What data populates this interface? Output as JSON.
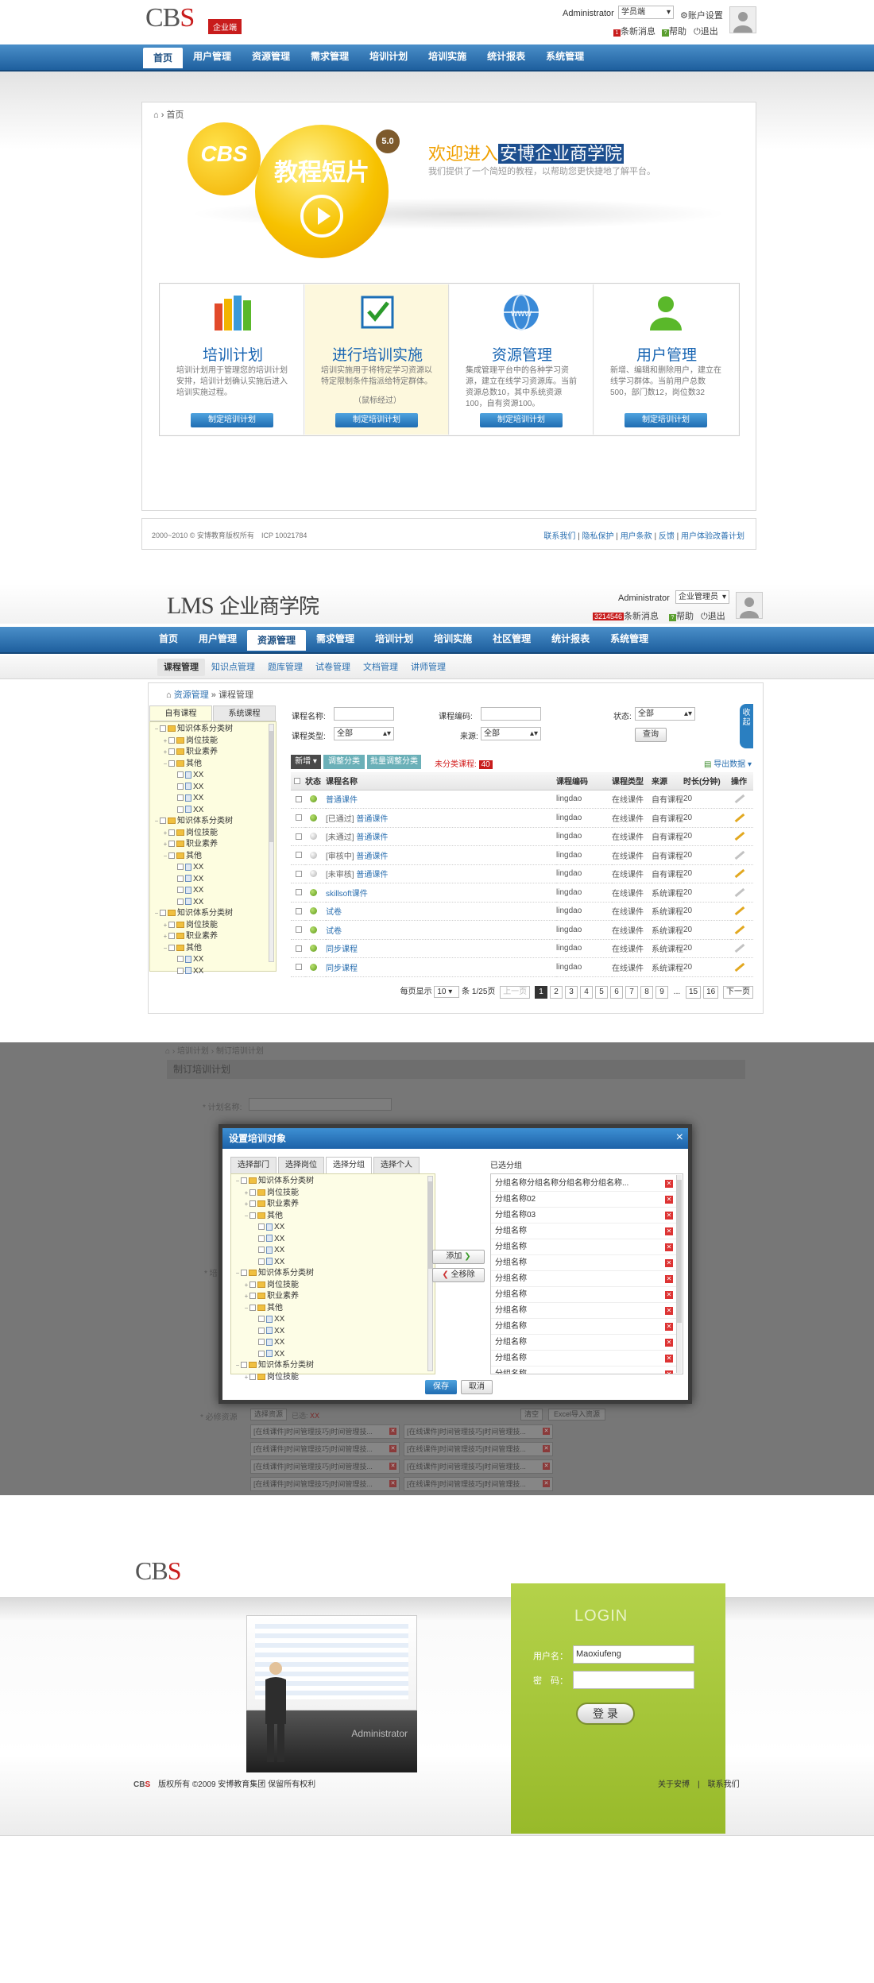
{
  "s1": {
    "logo_a": "CB",
    "logo_b": "S",
    "tag": "企业端",
    "user": "Administrator",
    "role": "学员端",
    "settings": "账户设置",
    "msgs_count": "1",
    "msgs": "条新消息",
    "help": "帮助",
    "logout": "退出",
    "nav": [
      "首页",
      "用户管理",
      "资源管理",
      "需求管理",
      "培训计划",
      "培训实施",
      "统计报表",
      "系统管理"
    ],
    "crumb": "首页",
    "hero": {
      "cbs": "CBS",
      "title": "教程短片",
      "ver": "5.0",
      "welcome_pre": "欢迎进入",
      "welcome_hl": "安博企业商学院",
      "sub": "我们提供了一个简短的教程，以帮助您更快捷地了解平台。"
    },
    "cards": [
      {
        "title": "培训计划",
        "desc": "培训计划用于管理您的培训计划安排，培训计划确认实施后进入培训实施过程。",
        "note": "",
        "btn": "制定培训计划"
      },
      {
        "title": "进行培训实施",
        "desc": "培训实施用于将特定学习资源以特定限制条件指派给特定群体。",
        "note": "（鼠标经过）",
        "btn": "制定培训计划"
      },
      {
        "title": "资源管理",
        "desc": "集成管理平台中的各种学习资源，建立在线学习资源库。当前资源总数10，其中系统资源100，自有资源100。",
        "note": "",
        "btn": "制定培训计划"
      },
      {
        "title": "用户管理",
        "desc": "新增、编辑和删除用户，建立在线学习群体。当前用户总数500，部门数12，岗位数32",
        "note": "",
        "btn": "制定培训计划"
      }
    ],
    "footer_copy": "2000~2010 © 安博教育版权所有",
    "footer_icp": "ICP 10021784",
    "footer_links": [
      "联系我们",
      "隐私保护",
      "用户条款",
      "反馈",
      "用户体验改善计划"
    ]
  },
  "s2": {
    "logo_a": "LMS",
    "logo_b": "企业商学院",
    "user": "Administrator",
    "role": "企业管理员",
    "msgs_count": "3214546",
    "msgs": "条新消息",
    "help": "帮助",
    "logout": "退出",
    "nav": [
      "首页",
      "用户管理",
      "资源管理",
      "需求管理",
      "培训计划",
      "培训实施",
      "社区管理",
      "统计报表",
      "系统管理"
    ],
    "subnav": [
      "课程管理",
      "知识点管理",
      "题库管理",
      "试卷管理",
      "文档管理",
      "讲师管理"
    ],
    "crumb_link": "资源管理",
    "crumb_sep": "»",
    "crumb_cur": "课程管理",
    "tabs": [
      "自有课程",
      "系统课程"
    ],
    "tree": [
      {
        "d": 0,
        "t": "f",
        "l": "知识体系分类树",
        "tg": "−"
      },
      {
        "d": 1,
        "t": "f",
        "l": "岗位技能",
        "tg": "+"
      },
      {
        "d": 1,
        "t": "f",
        "l": "职业素养",
        "tg": "+"
      },
      {
        "d": 1,
        "t": "f",
        "l": "其他",
        "tg": "−"
      },
      {
        "d": 2,
        "t": "d",
        "l": "XX",
        "tg": ""
      },
      {
        "d": 2,
        "t": "d",
        "l": "XX",
        "tg": ""
      },
      {
        "d": 2,
        "t": "d",
        "l": "XX",
        "tg": ""
      },
      {
        "d": 2,
        "t": "d",
        "l": "XX",
        "tg": ""
      },
      {
        "d": 0,
        "t": "f",
        "l": "知识体系分类树",
        "tg": "−"
      },
      {
        "d": 1,
        "t": "f",
        "l": "岗位技能",
        "tg": "+"
      },
      {
        "d": 1,
        "t": "f",
        "l": "职业素养",
        "tg": "+"
      },
      {
        "d": 1,
        "t": "f",
        "l": "其他",
        "tg": "−"
      },
      {
        "d": 2,
        "t": "d",
        "l": "XX",
        "tg": ""
      },
      {
        "d": 2,
        "t": "d",
        "l": "XX",
        "tg": ""
      },
      {
        "d": 2,
        "t": "d",
        "l": "XX",
        "tg": ""
      },
      {
        "d": 2,
        "t": "d",
        "l": "XX",
        "tg": ""
      },
      {
        "d": 0,
        "t": "f",
        "l": "知识体系分类树",
        "tg": "−"
      },
      {
        "d": 1,
        "t": "f",
        "l": "岗位技能",
        "tg": "+"
      },
      {
        "d": 1,
        "t": "f",
        "l": "职业素养",
        "tg": "+"
      },
      {
        "d": 1,
        "t": "f",
        "l": "其他",
        "tg": "−"
      },
      {
        "d": 2,
        "t": "d",
        "l": "XX",
        "tg": ""
      },
      {
        "d": 2,
        "t": "d",
        "l": "XX",
        "tg": ""
      }
    ],
    "f_name": "课程名称:",
    "f_code": "课程编码:",
    "f_status": "状态:",
    "f_status_v": "全部",
    "f_type": "课程类型:",
    "f_type_v": "全部",
    "f_src": "来源:",
    "f_src_v": "全部",
    "f_query": "查询",
    "collapse": "收起",
    "tb_new": "新增",
    "tb_adj": "调整分类",
    "tb_batch": "批量调整分类",
    "tb_uncls": "未分类课程:",
    "tb_uncls_n": "40",
    "tb_export": "导出数据",
    "cols": [
      "状态",
      "课程名称",
      "课程编码",
      "课程类型",
      "来源",
      "时长(分钟)",
      "操作"
    ],
    "rows": [
      {
        "g": true,
        "pre": "",
        "name": "普通课件",
        "code": "lingdao",
        "type": "在线课件",
        "src": "自有课程",
        "len": "20",
        "pen": false
      },
      {
        "g": true,
        "pre": "[已通过]",
        "name": "普通课件",
        "code": "lingdao",
        "type": "在线课件",
        "src": "自有课程",
        "len": "20",
        "pen": true
      },
      {
        "g": false,
        "pre": "[未通过]",
        "name": "普通课件",
        "code": "lingdao",
        "type": "在线课件",
        "src": "自有课程",
        "len": "20",
        "pen": true
      },
      {
        "g": false,
        "pre": "[审核中]",
        "name": "普通课件",
        "code": "lingdao",
        "type": "在线课件",
        "src": "自有课程",
        "len": "20",
        "pen": false
      },
      {
        "g": false,
        "pre": "[未审核]",
        "name": "普通课件",
        "code": "lingdao",
        "type": "在线课件",
        "src": "自有课程",
        "len": "20",
        "pen": true
      },
      {
        "g": true,
        "pre": "",
        "name": "skillsoft课件",
        "code": "lingdao",
        "type": "在线课件",
        "src": "系统课程",
        "len": "20",
        "pen": false
      },
      {
        "g": true,
        "pre": "",
        "name": "试卷",
        "code": "lingdao",
        "type": "在线课件",
        "src": "系统课程",
        "len": "20",
        "pen": true
      },
      {
        "g": true,
        "pre": "",
        "name": "试卷",
        "code": "lingdao",
        "type": "在线课件",
        "src": "系统课程",
        "len": "20",
        "pen": true
      },
      {
        "g": true,
        "pre": "",
        "name": "同步课程",
        "code": "lingdao",
        "type": "在线课件",
        "src": "系统课程",
        "len": "20",
        "pen": false
      },
      {
        "g": true,
        "pre": "",
        "name": "同步课程",
        "code": "lingdao",
        "type": "在线课件",
        "src": "系统课程",
        "len": "20",
        "pen": true
      }
    ],
    "pg_pre": "每页显示",
    "pg_size": "10",
    "pg_info": "条  1/25页",
    "pg_prev": "上一页",
    "pg_nums": [
      "1",
      "2",
      "3",
      "4",
      "5",
      "6",
      "7",
      "8",
      "9",
      "...",
      "15",
      "16"
    ],
    "pg_next": "下一页"
  },
  "s3": {
    "crumb_a": "培训计划",
    "crumb_b": "制订培训计划",
    "title": "制订培训计划",
    "f1": "* 计划名称:",
    "f2": "* 培",
    "req": "* 必修资源",
    "sel_btn": "选择资源",
    "sel_done": "已选:",
    "sel_n": "XX",
    "clr": "清空",
    "excel": "Excel导入资源",
    "res_items": [
      "[在线课件]时间管理技巧|时间管理技...",
      "[在线课件]时间管理技巧|时间管理技...",
      "[在线课件]时间管理技巧|时间管理技...",
      "[在线课件]时间管理技巧|时间管理技...",
      "[在线课件]时间管理技巧|时间管理技...",
      "[在线课件]时间管理技巧|时间管理技...",
      "[在线课件]时间管理技巧|时间管理技...",
      "[在线课件]时间管理技巧|时间管理技..."
    ],
    "modal_title": "设置培训对象",
    "close": "×",
    "mtabs": [
      "选择部门",
      "选择岗位",
      "选择分组",
      "选择个人"
    ],
    "mtree": [
      {
        "d": 0,
        "t": "f",
        "l": "知识体系分类树",
        "tg": "−"
      },
      {
        "d": 1,
        "t": "f",
        "l": "岗位技能",
        "tg": "+"
      },
      {
        "d": 1,
        "t": "f",
        "l": "职业素养",
        "tg": "+"
      },
      {
        "d": 1,
        "t": "f",
        "l": "其他",
        "tg": "−"
      },
      {
        "d": 2,
        "t": "d",
        "l": "XX",
        "tg": ""
      },
      {
        "d": 2,
        "t": "d",
        "l": "XX",
        "tg": ""
      },
      {
        "d": 2,
        "t": "d",
        "l": "XX",
        "tg": ""
      },
      {
        "d": 2,
        "t": "d",
        "l": "XX",
        "tg": ""
      },
      {
        "d": 0,
        "t": "f",
        "l": "知识体系分类树",
        "tg": "−"
      },
      {
        "d": 1,
        "t": "f",
        "l": "岗位技能",
        "tg": "+"
      },
      {
        "d": 1,
        "t": "f",
        "l": "职业素养",
        "tg": "+"
      },
      {
        "d": 1,
        "t": "f",
        "l": "其他",
        "tg": "−"
      },
      {
        "d": 2,
        "t": "d",
        "l": "XX",
        "tg": ""
      },
      {
        "d": 2,
        "t": "d",
        "l": "XX",
        "tg": ""
      },
      {
        "d": 2,
        "t": "d",
        "l": "XX",
        "tg": ""
      },
      {
        "d": 2,
        "t": "d",
        "l": "XX",
        "tg": ""
      },
      {
        "d": 0,
        "t": "f",
        "l": "知识体系分类树",
        "tg": "−"
      },
      {
        "d": 1,
        "t": "f",
        "l": "岗位技能",
        "tg": "+"
      }
    ],
    "add": "添加",
    "remove_all": "全移除",
    "selected_title": "已选分组",
    "selected": [
      "分组名称分组名称分组名称分组名称...",
      "分组名称02",
      "分组名称03",
      "分组名称",
      "分组名称",
      "分组名称",
      "分组名称",
      "分组名称",
      "分组名称",
      "分组名称",
      "分组名称",
      "分组名称",
      "分组名称"
    ],
    "save": "保存",
    "cancel": "取消"
  },
  "s4": {
    "logo_a": "CB",
    "logo_b": "S",
    "login_title": "LOGIN",
    "user_label": "用户名：",
    "user_value": "Maoxiufeng",
    "pwd_label": "密　码：",
    "submit": "登 录",
    "box_label": "Administrator",
    "footer_logo_a": "CB",
    "footer_logo_b": "S",
    "footer_copy": "版权所有 ©2009 安博教育集团 保留所有权利",
    "footer_links": [
      "关于安博",
      "联系我们"
    ]
  },
  "colors": {
    "nav": "#1e5f9e",
    "accent": "#c81c1c",
    "login_green": "#a9c93a",
    "tree_bg": "#fdfde0"
  }
}
